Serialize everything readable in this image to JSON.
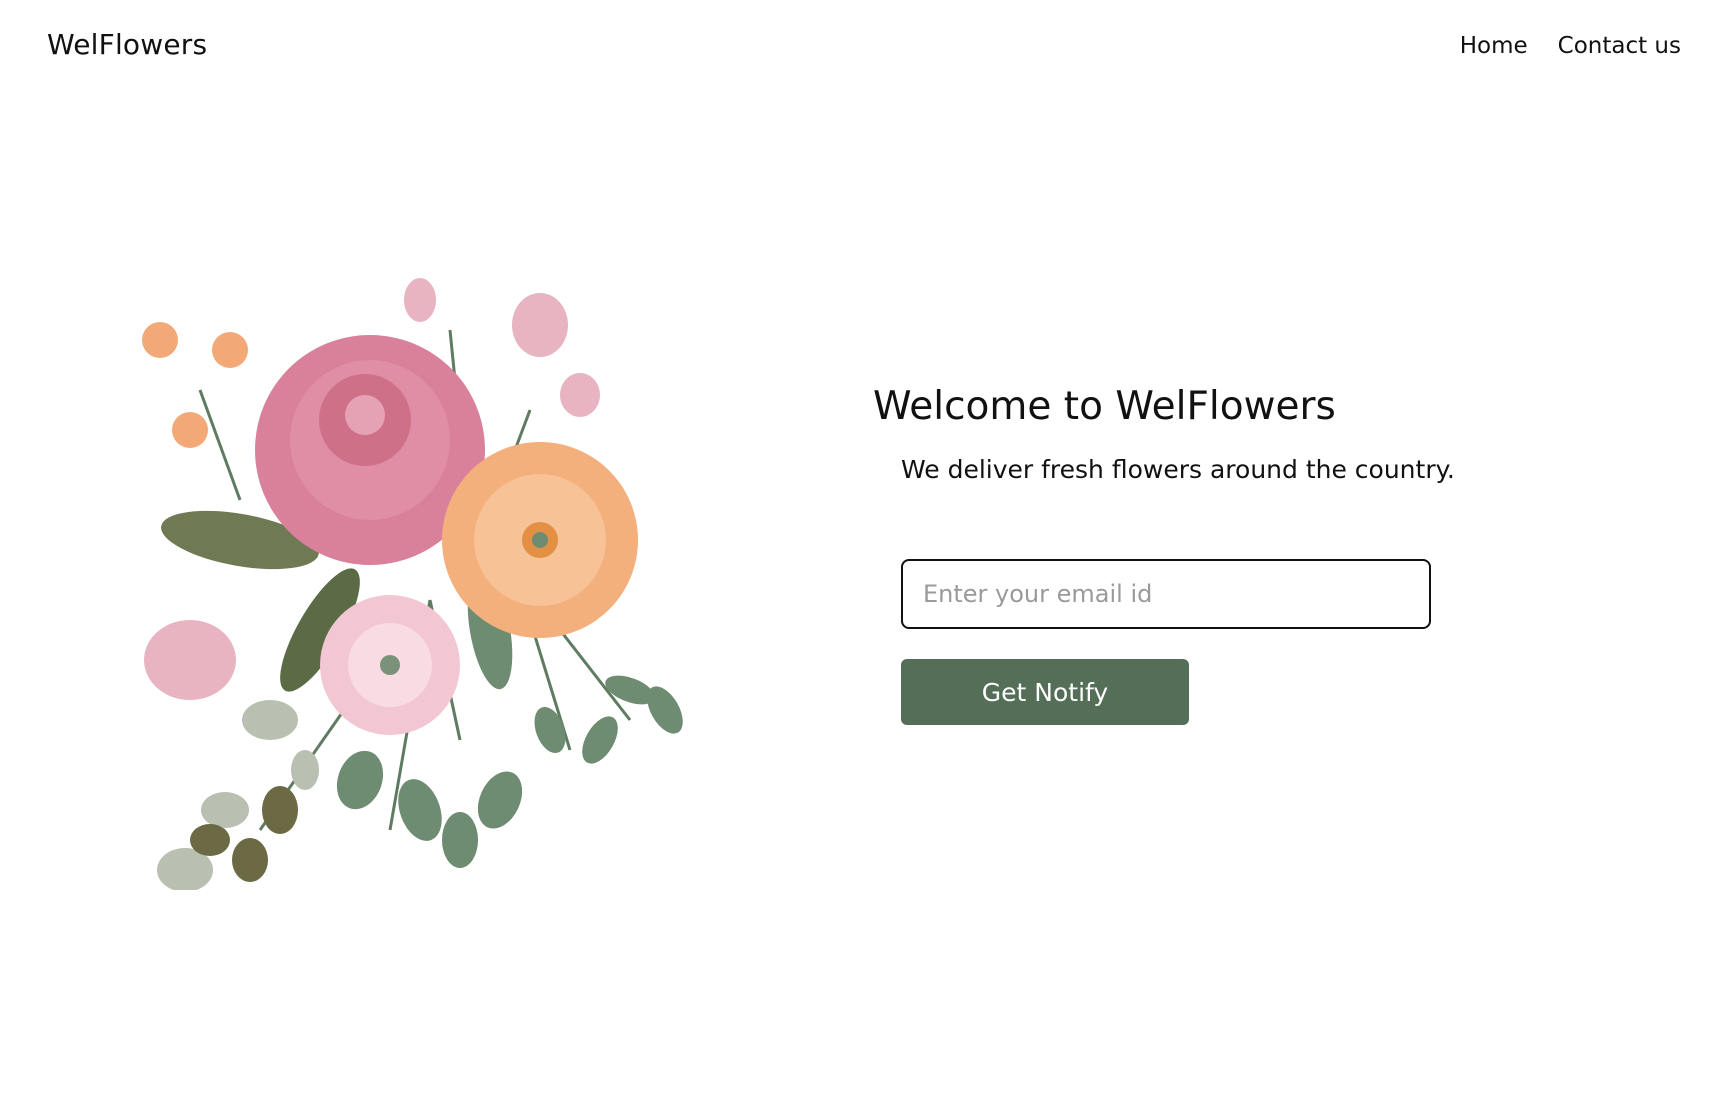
{
  "header": {
    "brand": "WelFlowers",
    "nav": [
      {
        "label": "Home"
      },
      {
        "label": "Contact us"
      }
    ]
  },
  "hero": {
    "image_icon": "flower-bouquet-illustration",
    "title": "Welcome to WelFlowers",
    "subtitle": "We deliver fresh flowers around the country.",
    "email_input": {
      "value": "",
      "placeholder": "Enter your email id"
    },
    "button_label": "Get Notify"
  },
  "colors": {
    "button_bg": "#546e58",
    "text": "#111111",
    "placeholder": "#9a9a9a",
    "rose": "#d9809a",
    "peach": "#f4b07c",
    "leaf": "#5f7c62"
  }
}
